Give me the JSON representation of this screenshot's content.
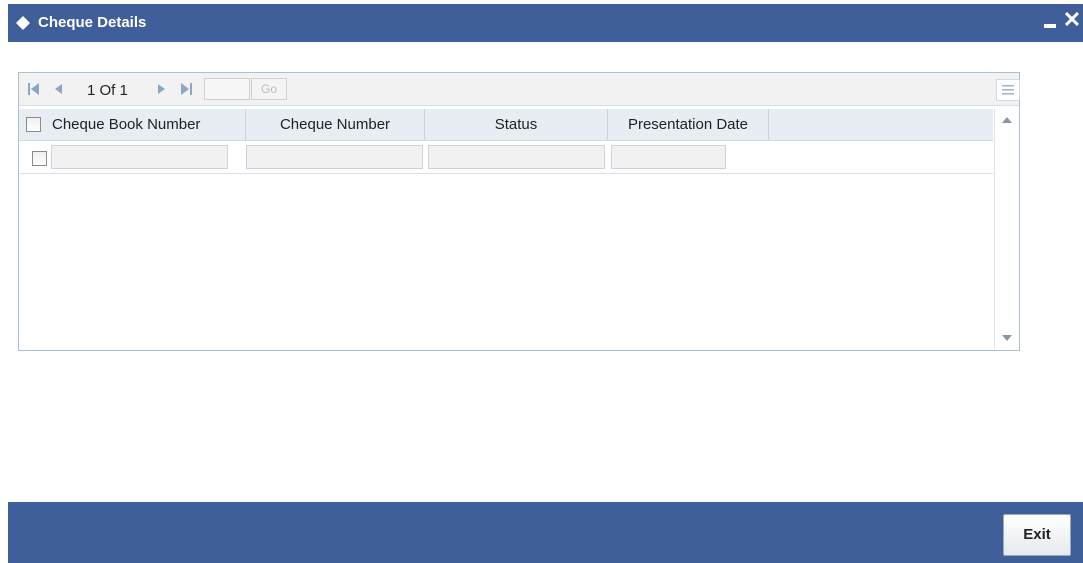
{
  "window": {
    "title": "Cheque Details"
  },
  "pagination": {
    "current": "1",
    "of_label": "Of",
    "total": "1",
    "go_label": "Go",
    "page_input": ""
  },
  "table": {
    "columns": [
      "Cheque Book Number",
      "Cheque Number",
      "Status",
      "Presentation Date"
    ],
    "rows": [
      {
        "cheque_book_number": "",
        "cheque_number": "",
        "status": "",
        "presentation_date": ""
      }
    ]
  },
  "footer": {
    "exit_label": "Exit"
  },
  "colors": {
    "titlebar": "#3f5e9a",
    "footer": "#3f5e9a",
    "grid_border": "#a9c0d6",
    "header_bg": "#e8edf4"
  },
  "icons": [
    "diamond-icon",
    "minimize-icon",
    "close-icon",
    "first-page-icon",
    "prev-page-icon",
    "next-page-icon",
    "last-page-icon",
    "column-view-icon",
    "scroll-up-icon",
    "scroll-down-icon"
  ]
}
